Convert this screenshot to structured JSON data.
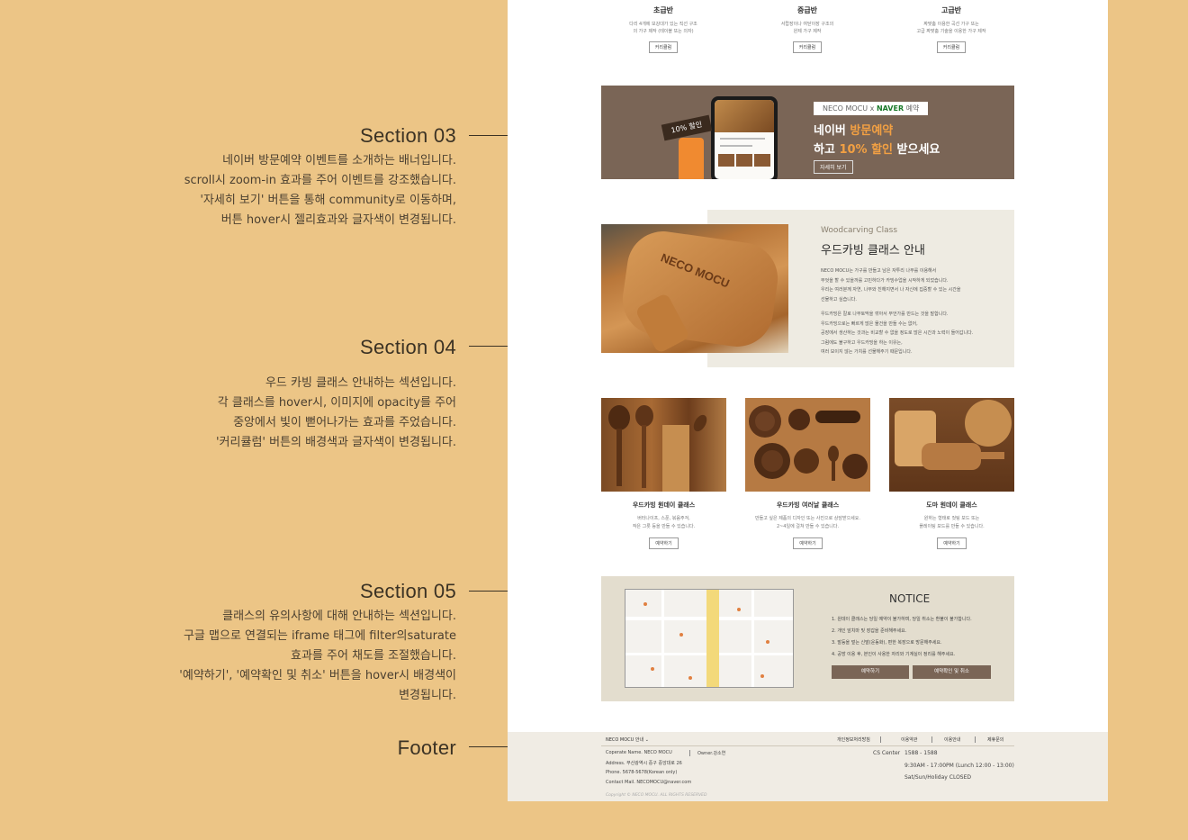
{
  "annotations": [
    {
      "title": "Section 03",
      "lines": [
        "네이버 방문예약 이벤트를 소개하는 배너입니다.",
        "scroll시 zoom-in 효과를 주어 이벤트를 강조했습니다.",
        "'자세히 보기' 버튼을 통해 community로 이동하며,",
        "버튼 hover시 젤리효과와 글자색이 변경됩니다."
      ]
    },
    {
      "title": "Section 04",
      "lines": [
        "우드 카빙 클래스 안내하는 섹션입니다.",
        "각 클래스를 hover시, 이미지에 opacity를 주어",
        "중앙에서 빛이 뻗어나가는 효과를 주었습니다.",
        "'커리큘럼' 버튼의 배경색과 글자색이 변경됩니다."
      ]
    },
    {
      "title": "Section 05",
      "lines": [
        "클래스의 유의사항에 대해 안내하는 섹션입니다.",
        "구글 맵으로 연결되는 iframe 태그에 filter의saturate",
        "효과를 주어 채도를 조절했습니다.",
        "'예약하기', '예약확인 및 취소' 버튼을 hover시 배경색이",
        "변경됩니다."
      ]
    },
    {
      "title": "Footer",
      "lines": []
    }
  ],
  "levels": [
    {
      "title": "초급반",
      "desc1": "다리 4개에 보강대가 있는 직선 구조",
      "desc2": "의 가구 제작 (테이블 또는 의자)",
      "button": "커리큘럼"
    },
    {
      "title": "중급반",
      "desc1": "서랍장이나 여닫이장 구조의",
      "desc2": "완제 가구 제작",
      "button": "커리큘럼"
    },
    {
      "title": "고급반",
      "desc1": "짜맞춤 이용한 곡선 가구 또는",
      "desc2": "고급 짜맞춤 기술을 이용한 가구 제작",
      "button": "커리큘럼"
    }
  ],
  "banner": {
    "collab_prefix": "NECO MOCU x ",
    "collab_naver": "NAVER",
    "collab_suffix": " 예약",
    "line1_a": "네이버 ",
    "line1_b": "방문예약",
    "line2_a": "하고 ",
    "line2_b": "10% 할인",
    "line2_c": " 받으세요",
    "tag": "10% 할인",
    "button": "자세히 보기"
  },
  "woodcarving": {
    "eng": "Woodcarving Class",
    "title": "우드카빙 클래스 안내",
    "logo": "NECO MOCU",
    "para1": [
      "NECO MOCU는 가구를 만들고 남은 자투리 나무를 이용해서",
      "무엇을 할 수 있을까를 고민하다가 카빙수업을 시작하게 되었습니다.",
      "우리는 여러분께 자연, 나무와 친해지면서 나 자신에 집중할 수 있는 시간을",
      "선물하고 싶습니다."
    ],
    "para2": [
      "우드카빙은 칼로 나무토막을 깎아서 무언가를 만드는 것을 말합니다.",
      "우드카빙으로는 빠르게 많은 물건을 만들 수는 없어,",
      "공장에서 생산하는 것과는 비교할 수 없을 정도로 많은 시간과 노력이 들어갑니다.",
      "그럼에도 불구하고 우드카빙을 하는 이유는,",
      "여러 보이지 않는 가치를 선물해주기 때문입니다."
    ]
  },
  "cards": [
    {
      "title": "우드카빙 원데이 클래스",
      "desc1": "버터나이프, 스푼, 볶음주걱,",
      "desc2": "작은 그릇 등을 만들 수 있습니다.",
      "button": "예약하기"
    },
    {
      "title": "우드카빙 여러날 클래스",
      "desc1": "만들고 싶은 제품의 디자인 또는 사진으로 상담받으세요.",
      "desc2": "2~4일에 걸쳐 만들 수 있습니다.",
      "button": "예약하기"
    },
    {
      "title": "도마 원데이 클래스",
      "desc1": "원하는 형태로 컷팅 보드 또는",
      "desc2": "플레이팅 보드를 만들 수 있습니다.",
      "button": "예약하기"
    }
  ],
  "notice": {
    "title": "NOTICE",
    "items": [
      "1. 원데이 클래스는 당일 예약이 불가하며, 당일 취소는 환불이 불가합니다.",
      "2. 개인 앞치마 및 장갑을 준비해주세요.",
      "3. 발등을 덮는 신발(운동화), 편한 복장으로 방문해주세요.",
      "4. 공방 이용 후, 본인이 사용한 자리와 기계실이 정리를 해주세요."
    ],
    "btn_reserve": "예약하기",
    "btn_check": "예약확인 및 취소"
  },
  "footer": {
    "brand": "NECO MOCU 안내",
    "nav": [
      "개인정보처리방침",
      "이용약관",
      "이용안내",
      "제휴문의"
    ],
    "company": "Coperate Name. NECO MOCU",
    "owner": "Owner.강소연",
    "address": "Address. 부산광역시 중구 중앙대로 26",
    "phone": "Phone. 5678-5678(Korean only)",
    "mail": "Contact Mail. NECOMOCU@naver.com",
    "cs_label": "CS Center",
    "cs_number": "1588 - 1588",
    "hours": "9:30AM - 17:00PM (Lunch 12:00 - 13:00)",
    "closed": "Sat/Sun/Holiday CLOSED",
    "copyright": "Copyright © NECO MOCU. ALL RIGHTS RESERVED"
  }
}
